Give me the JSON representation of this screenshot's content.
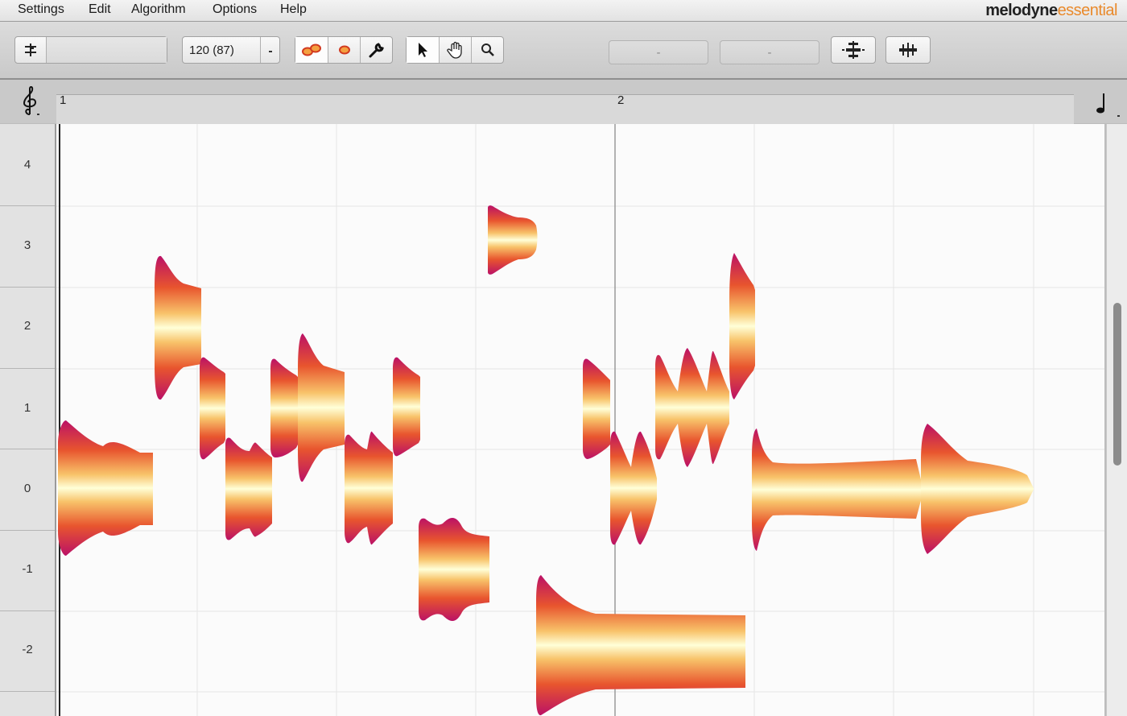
{
  "menu": {
    "items": [
      "Settings",
      "Edit",
      "Algorithm",
      "Options",
      "Help"
    ]
  },
  "brand": {
    "name": "melodyne",
    "edition": "essential"
  },
  "toolbar": {
    "tempo_value": "120 (87)",
    "readout_left": "-",
    "readout_right": "-"
  },
  "ruler": {
    "bars": [
      "1",
      "2"
    ]
  },
  "pitch_ruler": {
    "labels": [
      "4",
      "3",
      "2",
      "1",
      "0",
      "-1",
      "-2"
    ]
  },
  "colors": {
    "blob_outer": "#bb1166",
    "blob_mid": "#f07a2a",
    "blob_core": "#ffffd8",
    "accent": "#e98a2c"
  },
  "icons": [
    "snap-icon",
    "tempo-dropdown-icon",
    "main-tool-icon",
    "pitch-tool-icon",
    "wrench-icon",
    "pointer-icon",
    "hand-icon",
    "zoom-icon",
    "quantize-pitch-icon",
    "quantize-time-icon",
    "clef-icon",
    "note-value-icon"
  ]
}
